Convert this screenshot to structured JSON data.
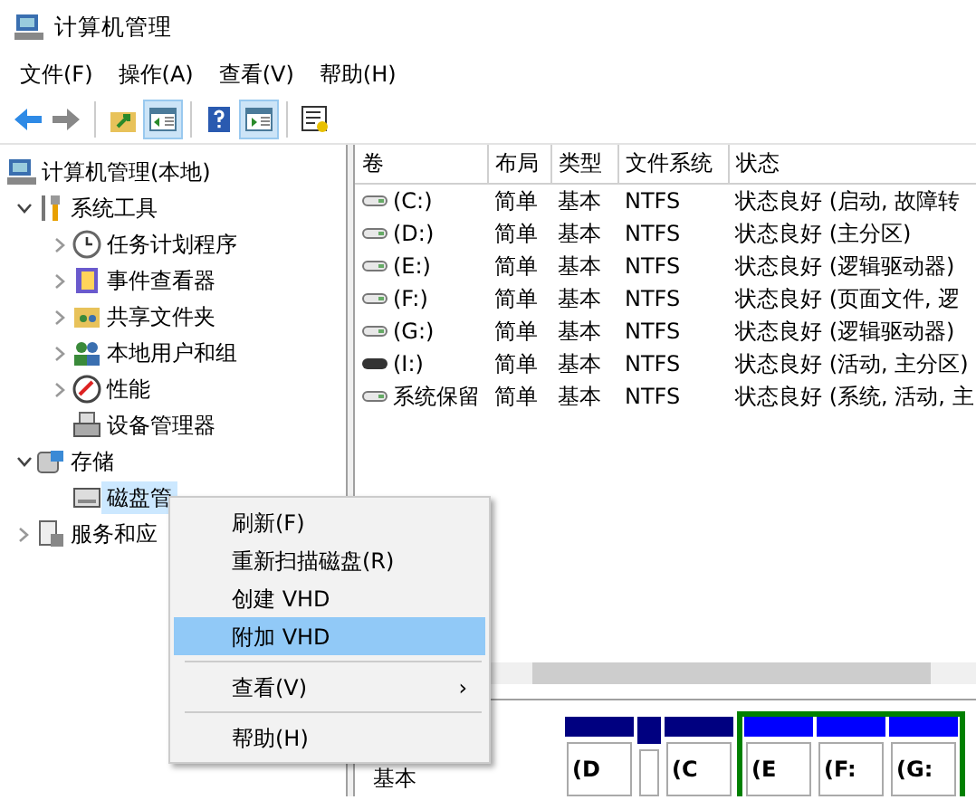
{
  "window": {
    "title": "计算机管理"
  },
  "menu_bar": [
    "文件(F)",
    "操作(A)",
    "查看(V)",
    "帮助(H)"
  ],
  "toolbar": [
    {
      "kind": "back",
      "selected": false
    },
    {
      "kind": "forward",
      "selected": false
    },
    {
      "kind": "separator"
    },
    {
      "kind": "up",
      "selected": false
    },
    {
      "kind": "console-tree",
      "selected": true
    },
    {
      "kind": "separator"
    },
    {
      "kind": "help",
      "selected": false
    },
    {
      "kind": "action-pane",
      "selected": true
    },
    {
      "kind": "separator"
    },
    {
      "kind": "properties",
      "selected": false
    }
  ],
  "tree": [
    {
      "label": "计算机管理(本地)",
      "kind": "computer",
      "selected": false,
      "children": [
        {
          "label": "系统工具",
          "kind": "tools",
          "expanded": true,
          "selected": false,
          "children": [
            {
              "label": "任务计划程序",
              "kind": "clock",
              "expanded": false,
              "selected": false
            },
            {
              "label": "事件查看器",
              "kind": "log",
              "expanded": false,
              "selected": false
            },
            {
              "label": "共享文件夹",
              "kind": "share",
              "expanded": false,
              "selected": false
            },
            {
              "label": "本地用户和组",
              "kind": "users",
              "expanded": false,
              "selected": false
            },
            {
              "label": "性能",
              "kind": "perf",
              "expanded": false,
              "selected": false
            },
            {
              "label": "设备管理器",
              "kind": "device",
              "selected": false
            }
          ]
        },
        {
          "label": "存储",
          "kind": "storage",
          "expanded": true,
          "selected": false,
          "children": [
            {
              "label": "磁盘管",
              "kind": "disk",
              "selected": true
            }
          ]
        },
        {
          "label": "服务和应",
          "kind": "services",
          "expanded": false,
          "selected": false
        }
      ]
    }
  ],
  "table": {
    "columns": [
      "卷",
      "布局",
      "类型",
      "文件系统",
      "状态"
    ],
    "rows": [
      {
        "cells": [
          "(C:)",
          "简单",
          "基本",
          "NTFS",
          "状态良好 (启动, 故障转"
        ],
        "kind": "disk"
      },
      {
        "cells": [
          "(D:)",
          "简单",
          "基本",
          "NTFS",
          "状态良好 (主分区)"
        ],
        "kind": "disk"
      },
      {
        "cells": [
          "(E:)",
          "简单",
          "基本",
          "NTFS",
          "状态良好 (逻辑驱动器)"
        ],
        "kind": "disk"
      },
      {
        "cells": [
          "(F:)",
          "简单",
          "基本",
          "NTFS",
          "状态良好 (页面文件, 逻"
        ],
        "kind": "disk"
      },
      {
        "cells": [
          "(G:)",
          "简单",
          "基本",
          "NTFS",
          "状态良好 (逻辑驱动器)"
        ],
        "kind": "disk"
      },
      {
        "cells": [
          "(I:)",
          "简单",
          "基本",
          "NTFS",
          "状态良好 (活动, 主分区)"
        ],
        "kind": "removable"
      },
      {
        "cells": [
          "系统保留",
          "简单",
          "基本",
          "NTFS",
          "状态良好 (系统, 活动, 主"
        ],
        "kind": "disk"
      }
    ]
  },
  "disk_view": {
    "label": "基本",
    "partitions": [
      {
        "label": "(D",
        "color": "#000080",
        "extended": false
      },
      {
        "color": "#000080",
        "extended": false
      },
      {
        "label": "(C",
        "color": "#000080",
        "extended": false
      },
      {
        "label": "(E",
        "color": "#0000ff",
        "extended": true
      },
      {
        "label": "(F:",
        "color": "#0000ff",
        "extended": true
      },
      {
        "label": "(G:",
        "color": "#0000ff",
        "extended": true
      }
    ]
  },
  "context_menu": [
    {
      "kind": "item",
      "label": "刷新(F)",
      "selected": false
    },
    {
      "kind": "item",
      "label": "重新扫描磁盘(R)",
      "selected": false
    },
    {
      "kind": "item",
      "label": "创建 VHD",
      "selected": false
    },
    {
      "kind": "item",
      "label": "附加 VHD",
      "selected": true
    },
    {
      "kind": "separator"
    },
    {
      "kind": "submenu",
      "label": "查看(V)",
      "arrow": "›",
      "selected": false
    },
    {
      "kind": "separator"
    },
    {
      "kind": "item",
      "label": "帮助(H)",
      "selected": false
    }
  ]
}
